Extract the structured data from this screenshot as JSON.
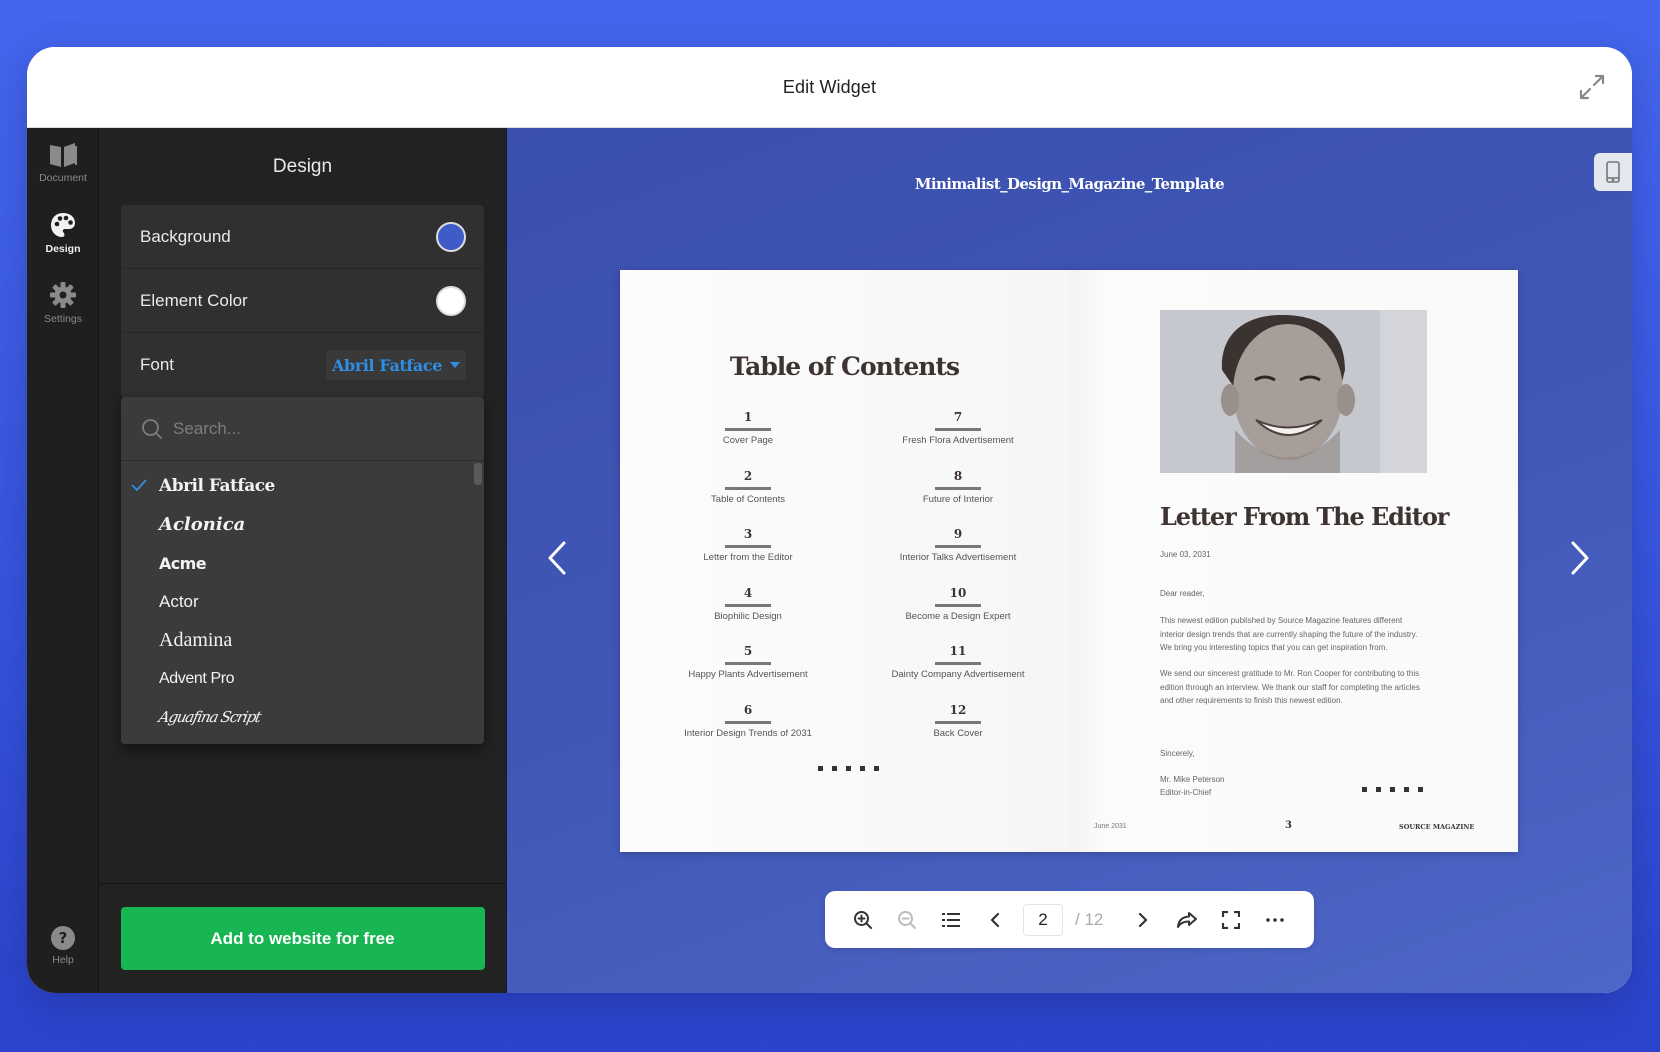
{
  "window": {
    "title": "Edit Widget",
    "expand_icon": "expand-arrows-icon"
  },
  "rail": {
    "items": [
      {
        "label": "Document",
        "icon": "open-book-icon",
        "active": false
      },
      {
        "label": "Design",
        "icon": "palette-icon",
        "active": true
      },
      {
        "label": "Settings",
        "icon": "gear-icon",
        "active": false
      }
    ],
    "help": {
      "label": "Help",
      "icon": "help-circle-icon"
    }
  },
  "panel": {
    "title": "Design",
    "background": {
      "label": "Background",
      "color": "#3f5bc8"
    },
    "element_color": {
      "label": "Element Color",
      "color": "#ffffff"
    },
    "font": {
      "label": "Font",
      "value": "Abril Fatface"
    },
    "dropdown": {
      "search_placeholder": "Search...",
      "search_value": "",
      "options": [
        "Abril Fatface",
        "Aclonica",
        "Acme",
        "Actor",
        "Adamina",
        "Advent Pro",
        "Aguafina Script"
      ],
      "selected": "Abril Fatface"
    },
    "cta_label": "Add to website for free"
  },
  "preview": {
    "document_title": "Minimalist_Design_Magazine_Template",
    "device_icon": "mobile-phone-icon",
    "left_page": {
      "heading": "Table of Contents",
      "col1": [
        {
          "num": "1",
          "label": "Cover Page"
        },
        {
          "num": "2",
          "label": "Table of Contents"
        },
        {
          "num": "3",
          "label": "Letter from the Editor"
        },
        {
          "num": "4",
          "label": "Biophilic Design"
        },
        {
          "num": "5",
          "label": "Happy Plants Advertisement"
        },
        {
          "num": "6",
          "label": "Interior Design Trends of 2031"
        }
      ],
      "col2": [
        {
          "num": "7",
          "label": "Fresh Flora Advertisement"
        },
        {
          "num": "8",
          "label": "Future of Interior"
        },
        {
          "num": "9",
          "label": "Interior Talks Advertisement"
        },
        {
          "num": "10",
          "label": "Become a Design Expert"
        },
        {
          "num": "11",
          "label": "Dainty Company Advertisement"
        },
        {
          "num": "12",
          "label": "Back Cover"
        }
      ]
    },
    "right_page": {
      "heading": "Letter From The Editor",
      "date": "June 03, 2031",
      "salutation": "Dear reader,",
      "para1": "This newest edition published by Source Magazine features different interior design trends that are currently shaping the future of the industry. We bring you interesting topics that you can get inspiration from.",
      "para2": "We send our sincerest gratitude to Mr. Ron Cooper for contributing to this edition through an interview. We thank our staff for completing the articles and other requirements to finish this newest edition.",
      "closing": "Sincerely,",
      "signature_name": "Mr. Mike Peterson",
      "signature_title": "Editor-in-Chief",
      "footer_left": "June 2031",
      "footer_page": "3",
      "footer_right": "SOURCE MAGAZINE"
    },
    "toolbar": {
      "current_page": "2",
      "total_pages": "/ 12"
    }
  }
}
